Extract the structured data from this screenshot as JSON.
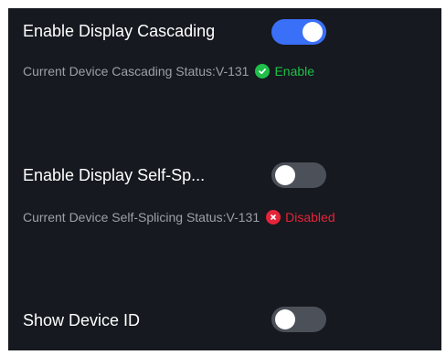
{
  "settings": [
    {
      "label": "Enable Display Cascading",
      "enabled": true,
      "status_prefix": "Current Device Cascading Status:V-131",
      "status_value": "Enable",
      "status_icon": "check-circle-icon",
      "status_color": "#1fbf4a"
    },
    {
      "label": "Enable Display Self-Sp...",
      "enabled": false,
      "status_prefix": "Current Device Self-Splicing Status:V-131",
      "status_value": "Disabled",
      "status_icon": "error-circle-icon",
      "status_color": "#e5243a"
    },
    {
      "label": "Show Device ID",
      "enabled": false
    }
  ],
  "colors": {
    "panel_bg": "#16191f",
    "toggle_on": "#3a6ff7",
    "toggle_off": "#4c5058",
    "status_text": "#9ca0a8"
  }
}
